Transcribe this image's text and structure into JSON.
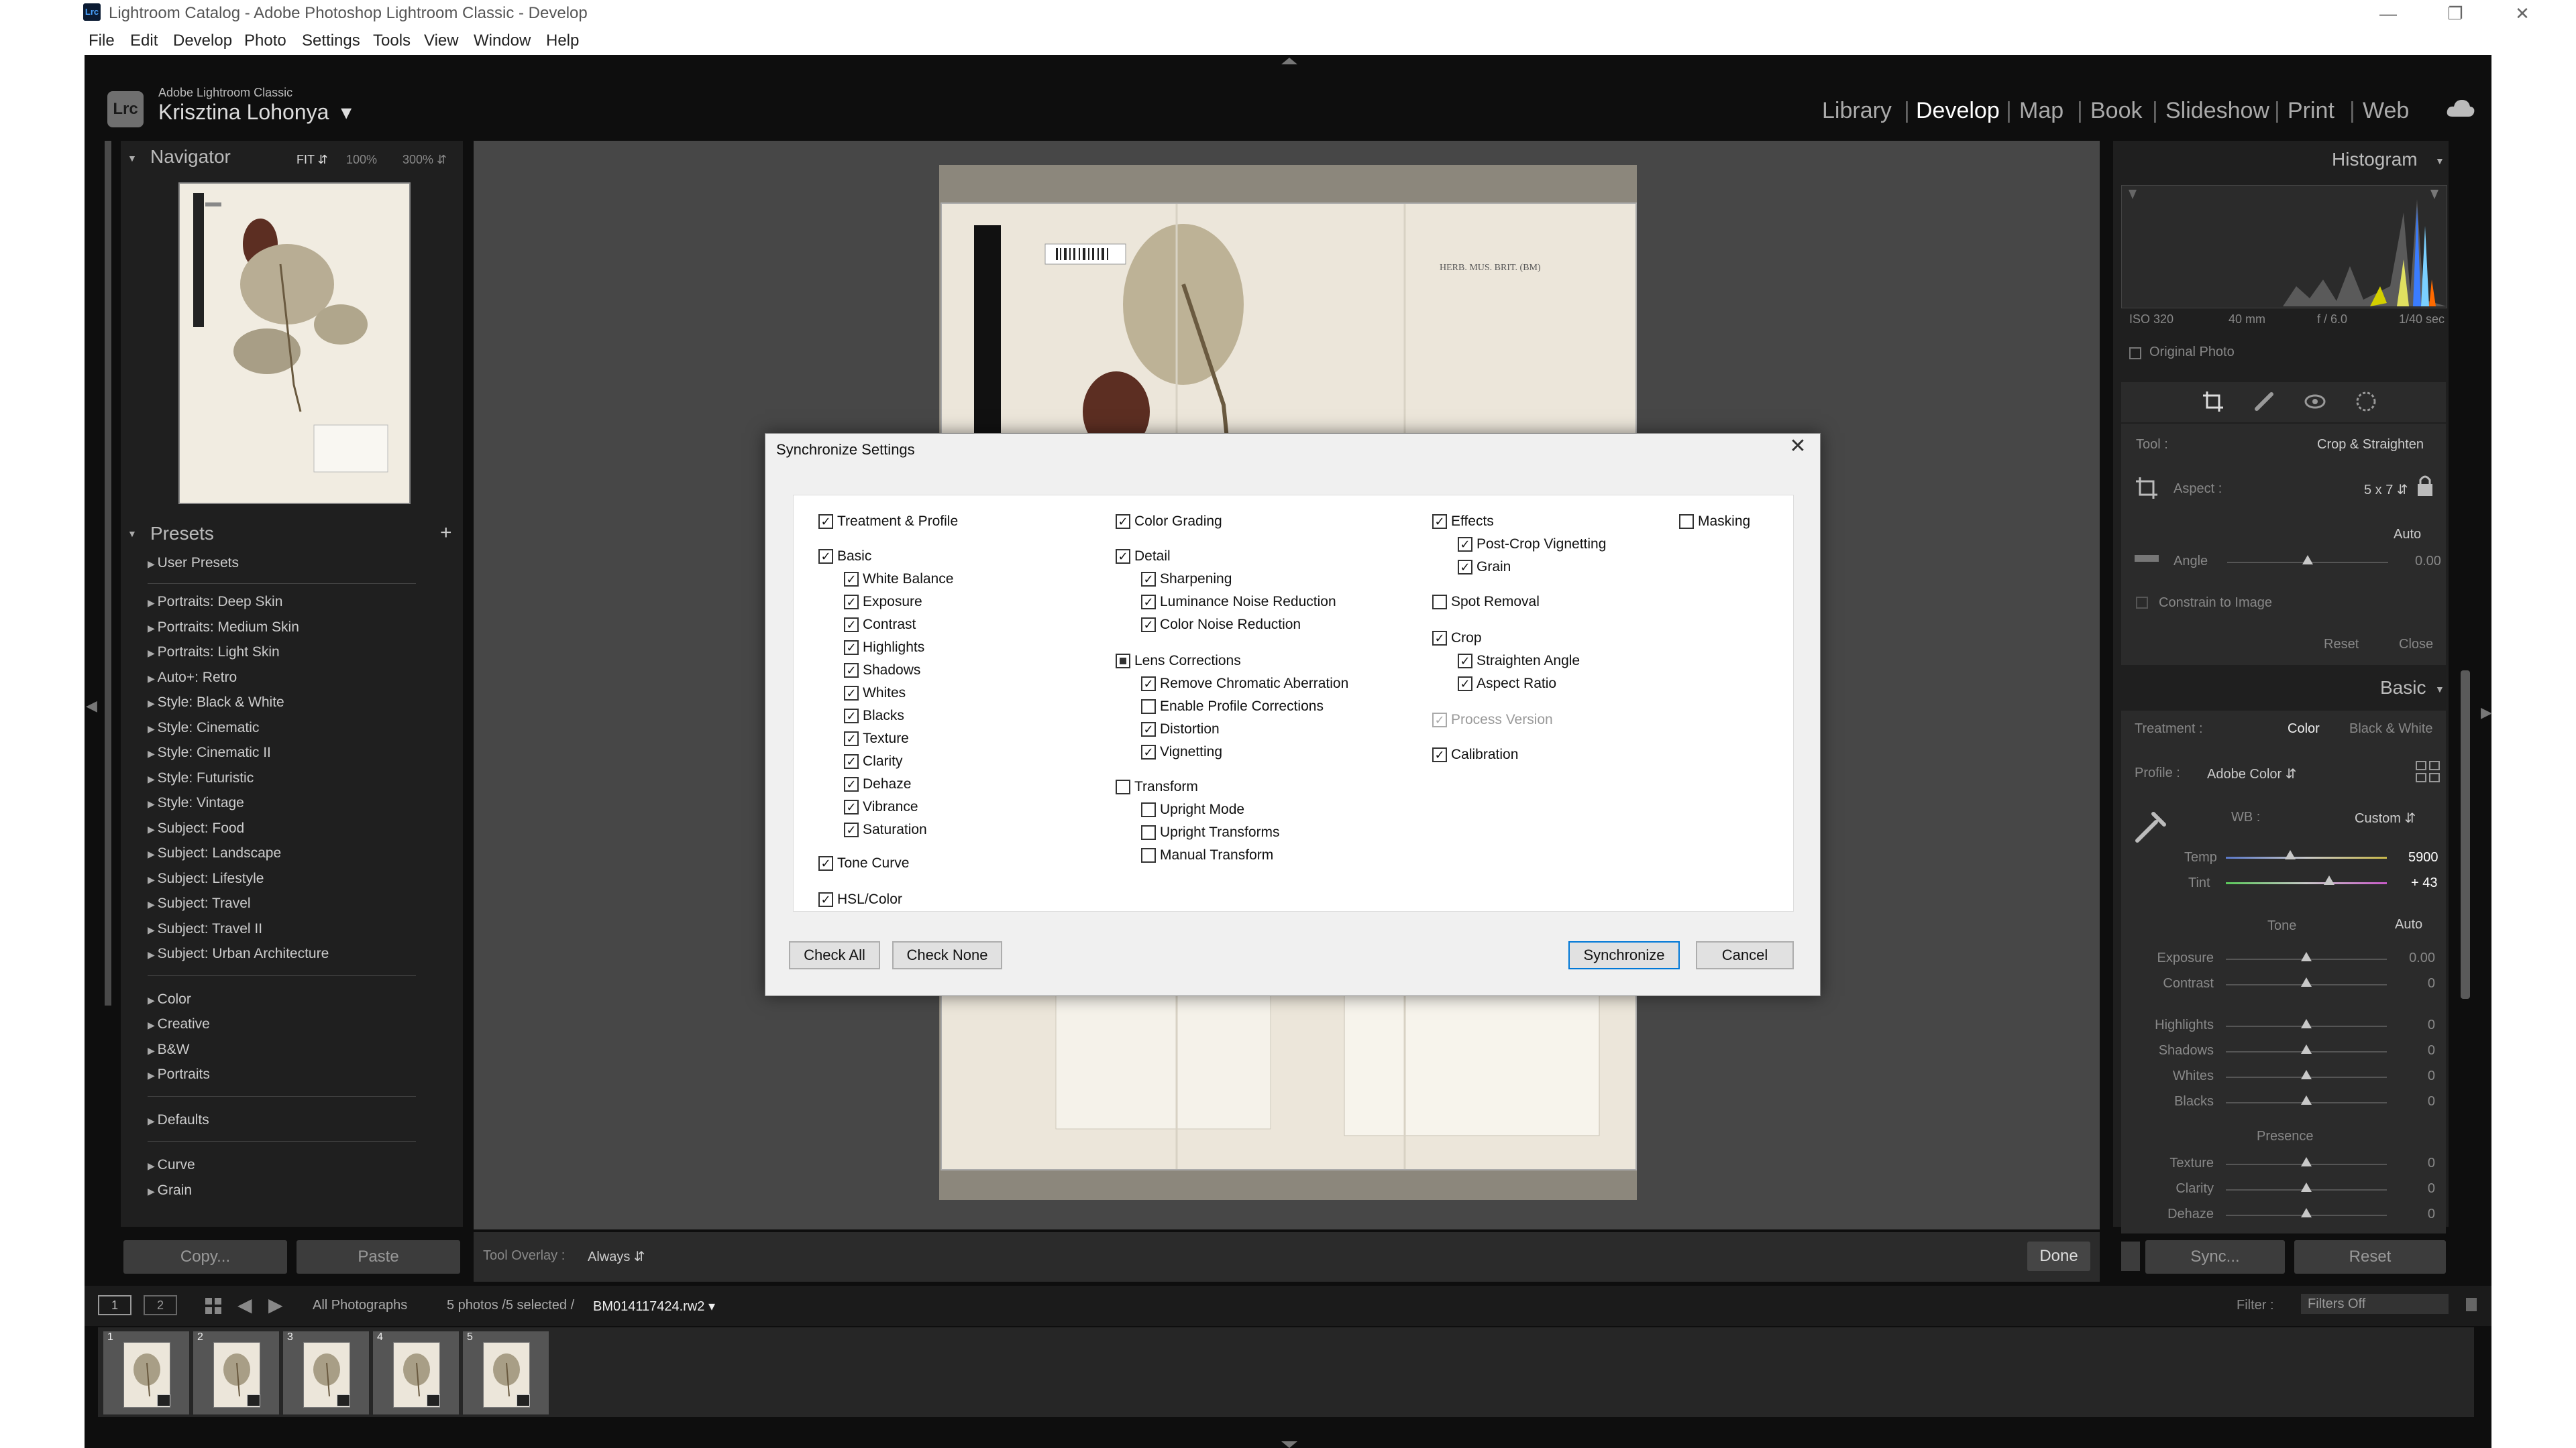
{
  "window": {
    "app_icon": "Lrc",
    "title": "Lightroom Catalog - Adobe Photoshop Lightroom Classic - Develop",
    "controls": [
      "minimize-icon",
      "restore-icon",
      "close-icon"
    ]
  },
  "menu": [
    "File",
    "Edit",
    "Develop",
    "Photo",
    "Settings",
    "Tools",
    "View",
    "Window",
    "Help"
  ],
  "identity": {
    "logo": "Lrc",
    "product": "Adobe Lightroom Classic",
    "user": "Krisztina Lohonya"
  },
  "modules": [
    "Library",
    "Develop",
    "Map",
    "Book",
    "Slideshow",
    "Print",
    "Web"
  ],
  "active_module": "Develop",
  "navigator": {
    "title": "Navigator",
    "fit": "FIT",
    "z100": "100%",
    "z300": "300%"
  },
  "presets": {
    "title": "Presets",
    "add": "+",
    "groups1": [
      "User Presets"
    ],
    "groups2": [
      "Portraits: Deep Skin",
      "Portraits: Medium Skin",
      "Portraits: Light Skin",
      "Auto+: Retro",
      "Style: Black & White",
      "Style: Cinematic",
      "Style: Cinematic II",
      "Style: Futuristic",
      "Style: Vintage",
      "Subject: Food",
      "Subject: Landscape",
      "Subject: Lifestyle",
      "Subject: Travel",
      "Subject: Travel II",
      "Subject: Urban Architecture"
    ],
    "groups3": [
      "Color",
      "Creative",
      "B&W",
      "Portraits"
    ],
    "groups4": [
      "Defaults"
    ],
    "groups5": [
      "Curve",
      "Grain"
    ]
  },
  "left_buttons": {
    "copy": "Copy...",
    "paste": "Paste"
  },
  "toolbar": {
    "overlay_label": "Tool Overlay :",
    "overlay_value": "Always",
    "done": "Done"
  },
  "histogram": {
    "title": "Histogram",
    "iso": "ISO 320",
    "focal": "40 mm",
    "aperture": "f / 6.0",
    "shutter": "1/40 sec",
    "original_photo": "Original Photo"
  },
  "crop": {
    "tool_label": "Tool :",
    "tool_value": "Crop & Straighten",
    "aspect_label": "Aspect :",
    "aspect_value": "5 x 7",
    "auto": "Auto",
    "angle_label": "Angle",
    "angle_value": "0.00",
    "constrain": "Constrain to Image",
    "reset": "Reset",
    "close": "Close"
  },
  "basic": {
    "title": "Basic",
    "treatment_label": "Treatment :",
    "color": "Color",
    "bw": "Black & White",
    "profile_label": "Profile :",
    "profile_value": "Adobe Color",
    "wb_label": "WB :",
    "wb_value": "Custom",
    "temp_label": "Temp",
    "temp_value": "5900",
    "temp_level": 0.4,
    "tint_label": "Tint",
    "tint_value": "+ 43",
    "tint_level": 0.64,
    "tone_label": "Tone",
    "tone_auto": "Auto",
    "tone": [
      {
        "label": "Exposure",
        "value": "0.00"
      },
      {
        "label": "Contrast",
        "value": "0"
      },
      {
        "label": "Highlights",
        "value": "0"
      },
      {
        "label": "Shadows",
        "value": "0"
      },
      {
        "label": "Whites",
        "value": "0"
      },
      {
        "label": "Blacks",
        "value": "0"
      }
    ],
    "presence_label": "Presence",
    "presence": [
      {
        "label": "Texture",
        "value": "0"
      },
      {
        "label": "Clarity",
        "value": "0"
      },
      {
        "label": "Dehaze",
        "value": "0"
      }
    ]
  },
  "right_buttons": {
    "sync": "Sync...",
    "reset": "Reset"
  },
  "filmstrip": {
    "view1": "1",
    "view2": "2",
    "source": "All Photographs",
    "count": "5 photos /5 selected /",
    "filename": "BM014117424.rw2",
    "filter_label": "Filter :",
    "filter_value": "Filters Off",
    "numbers": [
      "1",
      "2",
      "3",
      "4",
      "5"
    ]
  },
  "dialog": {
    "title": "Synchronize Settings",
    "col1": [
      {
        "label": "Treatment & Profile",
        "checked": true,
        "level": 0
      },
      {
        "label": "Basic",
        "checked": true,
        "level": 0
      },
      {
        "label": "White Balance",
        "checked": true,
        "level": 1
      },
      {
        "label": "Exposure",
        "checked": true,
        "level": 1
      },
      {
        "label": "Contrast",
        "checked": true,
        "level": 1
      },
      {
        "label": "Highlights",
        "checked": true,
        "level": 1
      },
      {
        "label": "Shadows",
        "checked": true,
        "level": 1
      },
      {
        "label": "Whites",
        "checked": true,
        "level": 1
      },
      {
        "label": "Blacks",
        "checked": true,
        "level": 1
      },
      {
        "label": "Texture",
        "checked": true,
        "level": 1
      },
      {
        "label": "Clarity",
        "checked": true,
        "level": 1
      },
      {
        "label": "Dehaze",
        "checked": true,
        "level": 1
      },
      {
        "label": "Vibrance",
        "checked": true,
        "level": 1
      },
      {
        "label": "Saturation",
        "checked": true,
        "level": 1
      },
      {
        "label": "Tone Curve",
        "checked": true,
        "level": 0
      },
      {
        "label": "HSL/Color",
        "checked": true,
        "level": 0
      }
    ],
    "col2": [
      {
        "label": "Color Grading",
        "checked": true,
        "level": 0
      },
      {
        "label": "Detail",
        "checked": true,
        "level": 0
      },
      {
        "label": "Sharpening",
        "checked": true,
        "level": 1
      },
      {
        "label": "Luminance Noise Reduction",
        "checked": true,
        "level": 1
      },
      {
        "label": "Color Noise Reduction",
        "checked": true,
        "level": 1
      },
      {
        "label": "Lens Corrections",
        "checked": "partial",
        "level": 0
      },
      {
        "label": "Remove Chromatic Aberration",
        "checked": true,
        "level": 1
      },
      {
        "label": "Enable Profile Corrections",
        "checked": false,
        "level": 1
      },
      {
        "label": "Distortion",
        "checked": true,
        "level": 1
      },
      {
        "label": "Vignetting",
        "checked": true,
        "level": 1
      },
      {
        "label": "Transform",
        "checked": false,
        "level": 0
      },
      {
        "label": "Upright Mode",
        "checked": false,
        "level": 1
      },
      {
        "label": "Upright Transforms",
        "checked": false,
        "level": 1
      },
      {
        "label": "Manual Transform",
        "checked": false,
        "level": 1
      }
    ],
    "col3": [
      {
        "label": "Effects",
        "checked": true,
        "level": 0
      },
      {
        "label": "Post-Crop Vignetting",
        "checked": true,
        "level": 1
      },
      {
        "label": "Grain",
        "checked": true,
        "level": 1
      },
      {
        "label": "Spot Removal",
        "checked": false,
        "level": 0
      },
      {
        "label": "Crop",
        "checked": true,
        "level": 0
      },
      {
        "label": "Straighten Angle",
        "checked": true,
        "level": 1
      },
      {
        "label": "Aspect Ratio",
        "checked": true,
        "level": 1
      },
      {
        "label": "Process Version",
        "checked": true,
        "level": 0,
        "disabled": true
      },
      {
        "label": "Calibration",
        "checked": true,
        "level": 0
      }
    ],
    "col4": [
      {
        "label": "Masking",
        "checked": false,
        "level": 0
      }
    ],
    "buttons": {
      "check_all": "Check All",
      "check_none": "Check None",
      "synchronize": "Synchronize",
      "cancel": "Cancel"
    }
  },
  "image_label": "HERB. MUS. BRIT. (BM)",
  "colors": {
    "lr_bg": "#0e0e0e",
    "panel": "#2b2b2b",
    "canvas": "#474747",
    "paper": "#ece6da",
    "dialog": "#f0f0f0",
    "accent": "#0078d7"
  }
}
